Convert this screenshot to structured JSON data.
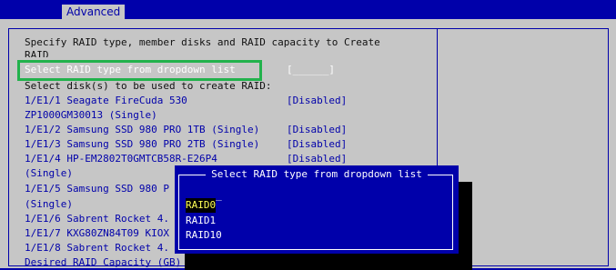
{
  "tabs": {
    "active": "Advanced"
  },
  "help_text": {
    "line1": "Specify RAID type, member disks and RAID capacity to Create",
    "line2": "RAID"
  },
  "raid_type": {
    "label": "Select RAID type from dropdown list",
    "value": "[______]"
  },
  "disks_heading": "Select disk(s) to be used to create RAID:",
  "disks": [
    {
      "line1": "1/E1/1 Seagate FireCuda 530",
      "status": "[Disabled]",
      "line2": "ZP1000GM30013 (Single)"
    },
    {
      "line1": "1/E1/2 Samsung SSD 980 PRO 1TB (Single)",
      "status": "[Disabled]"
    },
    {
      "line1": "1/E1/3 Samsung SSD 980 PRO 2TB (Single)",
      "status": "[Disabled]"
    },
    {
      "line1": "1/E1/4 HP-EM2802T0GMTCB58R-E26P4",
      "status": "[Disabled]",
      "line2": "(Single)"
    },
    {
      "line1": "1/E1/5 Samsung SSD 980 P"
    },
    {
      "line1": "(Single)"
    },
    {
      "line1": "1/E1/6 Sabrent Rocket 4."
    },
    {
      "line1": "1/E1/7 KXG80ZN84T09 KIOX"
    },
    {
      "line1": "1/E1/8 Sabrent Rocket 4."
    }
  ],
  "capacity_label": "Desired RAID Capacity (GB)",
  "popup": {
    "title": "Select RAID type from dropdown list",
    "placeholder": "______",
    "options": [
      "RAID0",
      "RAID1",
      "RAID10"
    ],
    "selected_index": 0
  },
  "colors": {
    "background": "#c6c6c6",
    "bios_blue": "#0000aa",
    "highlight_green": "#22b24c",
    "selected_text": "#ffff55"
  }
}
